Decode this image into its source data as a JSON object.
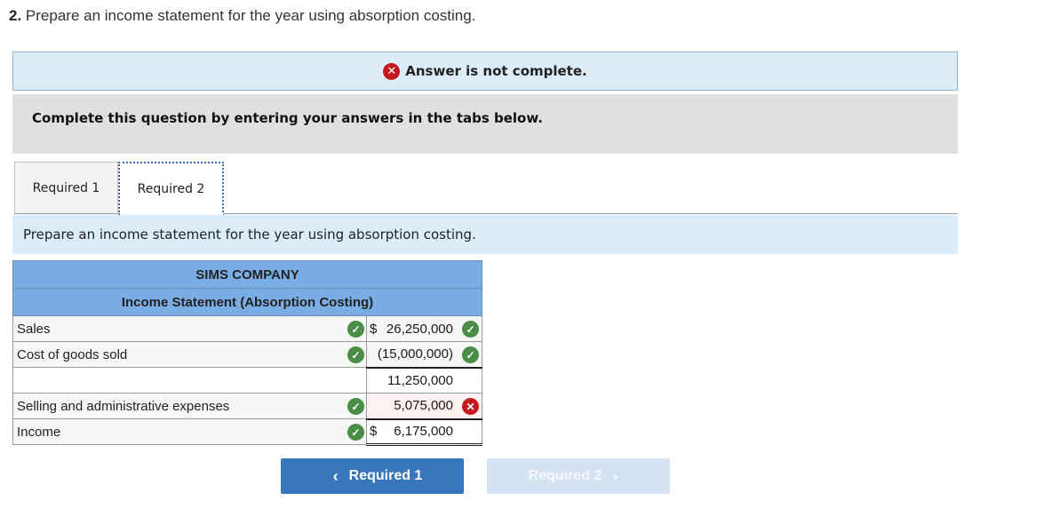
{
  "question": {
    "number": "2.",
    "text": "Prepare an income statement for the year using absorption costing."
  },
  "status": {
    "icon": "x-circle-icon",
    "text": "Answer is not complete."
  },
  "instructions": "Complete this question by entering your answers in the tabs below.",
  "tabs": [
    {
      "label": "Required 1",
      "active": false
    },
    {
      "label": "Required 2",
      "active": true
    }
  ],
  "prompt": "Prepare an income statement for the year using absorption costing.",
  "statement": {
    "company": "SIMS COMPANY",
    "title": "Income Statement (Absorption Costing)",
    "rows": [
      {
        "label": "Sales",
        "label_status": "correct",
        "dollar": "$",
        "value": "26,250,000",
        "value_status": "correct"
      },
      {
        "label": "Cost of goods sold",
        "label_status": "correct",
        "dollar": "",
        "value": "(15,000,000)",
        "value_status": "correct"
      },
      {
        "label": "",
        "label_status": "",
        "dollar": "",
        "value": "11,250,000",
        "value_status": ""
      },
      {
        "label": "Selling and administrative expenses",
        "label_status": "correct",
        "dollar": "",
        "value": "5,075,000",
        "value_status": "incorrect"
      },
      {
        "label": "Income",
        "label_status": "correct",
        "dollar": "$",
        "value": "6,175,000",
        "value_status": ""
      }
    ]
  },
  "nav": {
    "prev_label": "Required 1",
    "prev_chevron": "‹",
    "next_label": "Required 2",
    "next_chevron": "›"
  },
  "icons": {
    "check": "✓",
    "cross": "✕"
  },
  "colors": {
    "correct": "#4a8d47",
    "incorrect": "#c3191f",
    "header_blue": "#7aade3",
    "button_blue": "#3a76bb"
  }
}
